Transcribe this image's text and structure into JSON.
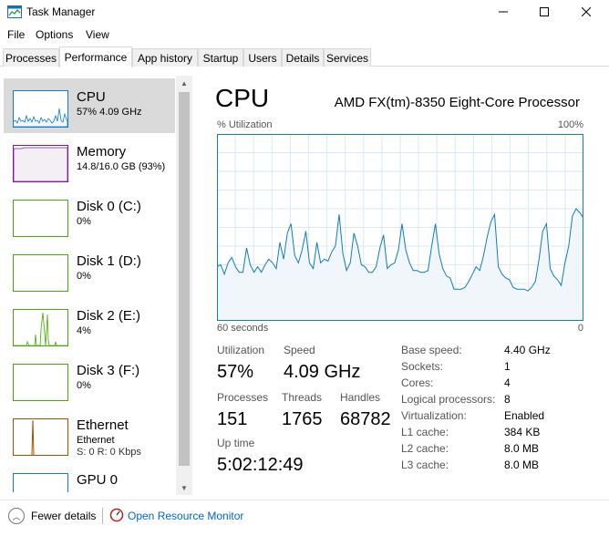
{
  "window": {
    "title": "Task Manager"
  },
  "menu": [
    "File",
    "Options",
    "View"
  ],
  "tabs": [
    "Processes",
    "Performance",
    "App history",
    "Startup",
    "Users",
    "Details",
    "Services"
  ],
  "sidebar": {
    "items": [
      {
        "title": "CPU",
        "sub": "57%  4.09 GHz",
        "sub2": "",
        "color": "#117dbb",
        "fill": "#f1f6fa"
      },
      {
        "title": "Memory",
        "sub": "14.8/16.0 GB (93%)",
        "sub2": "",
        "color": "#8b12ae",
        "fill": "#f4eef5"
      },
      {
        "title": "Disk 0 (C:)",
        "sub": "0%",
        "sub2": "",
        "color": "#4da60c",
        "fill": "#f1f7ec"
      },
      {
        "title": "Disk 1 (D:)",
        "sub": "0%",
        "sub2": "",
        "color": "#4da60c",
        "fill": "#f1f7ec"
      },
      {
        "title": "Disk 2 (E:)",
        "sub": "4%",
        "sub2": "",
        "color": "#4da60c",
        "fill": "#f1f7ec"
      },
      {
        "title": "Disk 3 (F:)",
        "sub": "0%",
        "sub2": "",
        "color": "#4da60c",
        "fill": "#f1f7ec"
      },
      {
        "title": "Ethernet",
        "sub": "Ethernet",
        "sub2": "S: 0 R: 0 Kbps",
        "color": "#a74f01",
        "fill": "#f8f1ec"
      },
      {
        "title": "GPU 0",
        "sub": "",
        "sub2": "",
        "color": "#117dbb",
        "fill": "#f1f6fa"
      }
    ]
  },
  "main": {
    "title": "CPU",
    "model": "AMD FX(tm)-8350 Eight-Core Processor",
    "util_label": "% Utilization",
    "util_max": "100%",
    "axis_left": "60 seconds",
    "axis_right": "0",
    "stats": {
      "utilization_label": "Utilization",
      "utilization": "57%",
      "speed_label": "Speed",
      "speed": "4.09 GHz",
      "processes_label": "Processes",
      "processes": "151",
      "threads_label": "Threads",
      "threads": "1765",
      "handles_label": "Handles",
      "handles": "68782",
      "uptime_label": "Up time",
      "uptime": "5:02:12:49"
    },
    "info": [
      {
        "key": "Base speed:",
        "value": "4.40 GHz"
      },
      {
        "key": "Sockets:",
        "value": "1"
      },
      {
        "key": "Cores:",
        "value": "4"
      },
      {
        "key": "Logical processors:",
        "value": "8"
      },
      {
        "key": "Virtualization:",
        "value": "Enabled"
      },
      {
        "key": "L1 cache:",
        "value": "384 KB"
      },
      {
        "key": "L2 cache:",
        "value": "8.0 MB"
      },
      {
        "key": "L3 cache:",
        "value": "8.0 MB"
      }
    ]
  },
  "cpu_history": [
    29,
    30,
    25,
    31,
    34,
    29,
    26,
    26,
    39,
    30,
    26,
    29,
    26,
    30,
    33,
    31,
    28,
    42,
    33,
    47,
    52,
    35,
    31,
    38,
    48,
    31,
    28,
    42,
    31,
    33,
    32,
    37,
    40,
    57,
    36,
    27,
    31,
    47,
    40,
    30,
    29,
    26,
    26,
    29,
    39,
    46,
    28,
    30,
    31,
    38,
    52,
    38,
    31,
    27,
    27,
    26,
    26,
    27,
    40,
    52,
    36,
    28,
    24,
    23,
    17,
    17,
    17,
    18,
    21,
    25,
    29,
    27,
    35,
    45,
    53,
    57,
    29,
    25,
    23,
    22,
    18,
    17,
    17,
    17,
    16,
    18,
    21,
    33,
    48,
    52,
    28,
    24,
    22,
    19,
    31,
    40,
    56,
    60,
    58,
    55
  ],
  "colors": {
    "cpu_line": "#117dbb",
    "cpu_fill": "#f1f6fa",
    "grid": "#d9eaf4",
    "border": "#117dbb"
  },
  "footer": {
    "fewer": "Fewer details",
    "monitor": "Open Resource Monitor"
  }
}
